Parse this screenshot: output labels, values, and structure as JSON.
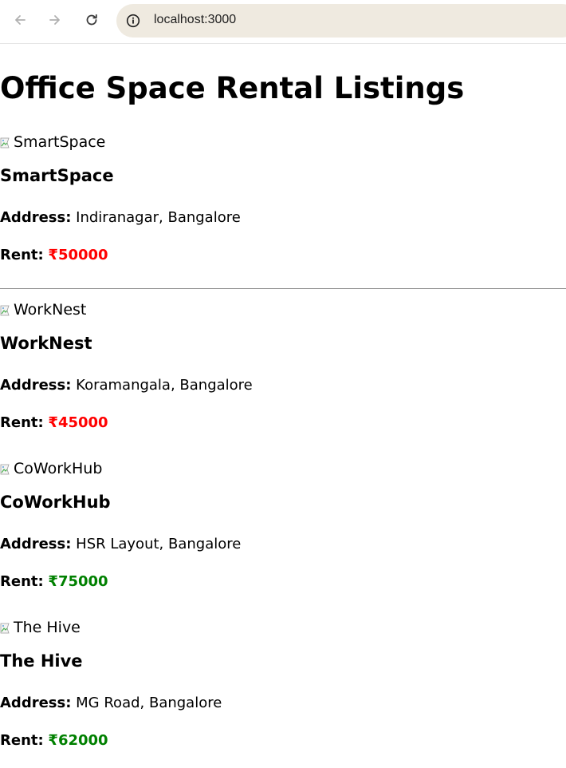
{
  "browser": {
    "url": "localhost:3000"
  },
  "page": {
    "title": "Office Space Rental Listings",
    "address_label": "Address:",
    "rent_label": "Rent:"
  },
  "listings": [
    {
      "name": "SmartSpace",
      "image_alt": "SmartSpace",
      "address": "Indiranagar, Bangalore",
      "rent": "₹50000",
      "rent_color": "#ff0000"
    },
    {
      "name": "WorkNest",
      "image_alt": "WorkNest",
      "address": "Koramangala, Bangalore",
      "rent": "₹45000",
      "rent_color": "#ff0000"
    },
    {
      "name": "CoWorkHub",
      "image_alt": "CoWorkHub",
      "address": "HSR Layout, Bangalore",
      "rent": "₹75000",
      "rent_color": "#008000"
    },
    {
      "name": "The Hive",
      "image_alt": "The Hive",
      "address": "MG Road, Bangalore",
      "rent": "₹62000",
      "rent_color": "#008000"
    }
  ]
}
